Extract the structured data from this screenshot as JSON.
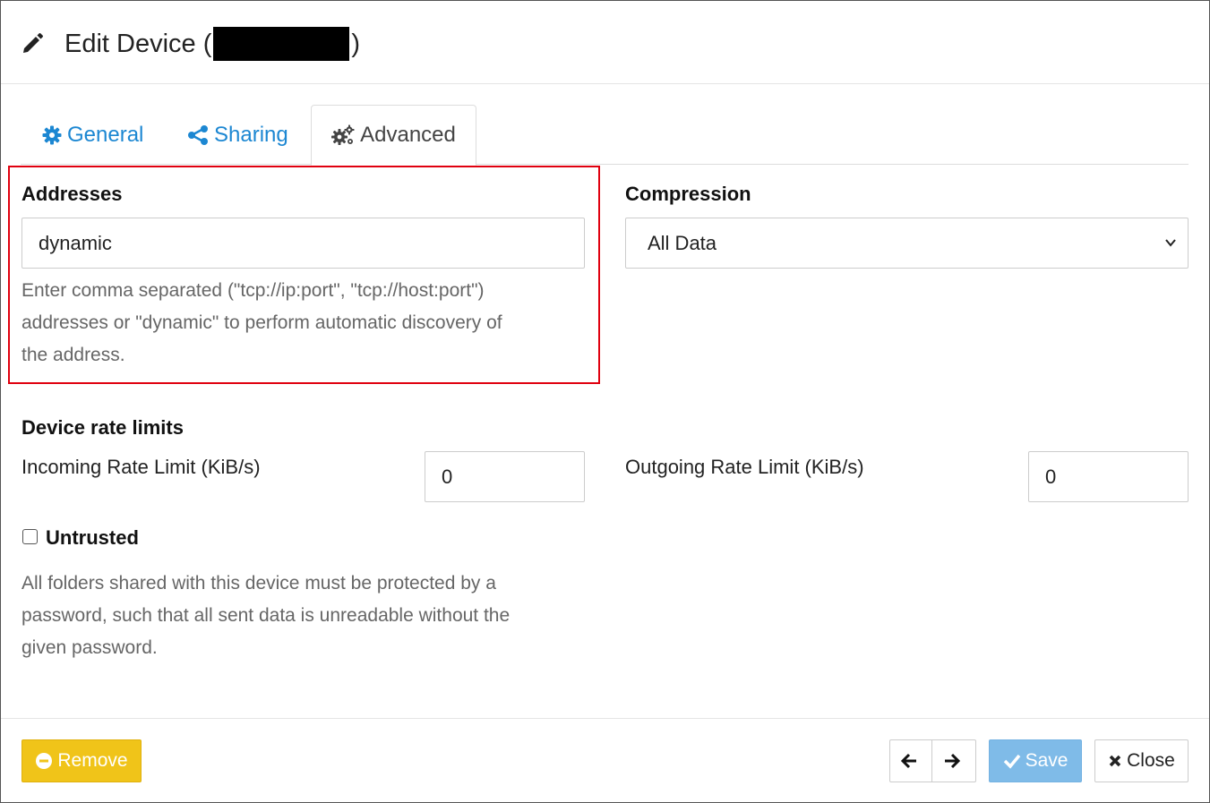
{
  "header": {
    "title_prefix": "Edit Device (",
    "title_suffix": ")",
    "icon": "pencil-icon"
  },
  "tabs": [
    {
      "label": "General",
      "icon": "gear-icon",
      "active": false
    },
    {
      "label": "Sharing",
      "icon": "share-icon",
      "active": false
    },
    {
      "label": "Advanced",
      "icon": "gears-icon",
      "active": true
    }
  ],
  "addresses": {
    "label": "Addresses",
    "value": "dynamic",
    "help_lines": [
      "Enter comma separated (\"tcp://ip:port\", \"tcp://host:port\")",
      "addresses or \"dynamic\" to perform automatic discovery of",
      "the address."
    ]
  },
  "compression": {
    "label": "Compression",
    "selected": "All Data"
  },
  "rate_limits": {
    "heading": "Device rate limits",
    "incoming_label": "Incoming Rate Limit (KiB/s)",
    "incoming_value": "0",
    "outgoing_label": "Outgoing Rate Limit (KiB/s)",
    "outgoing_value": "0"
  },
  "untrusted": {
    "label": "Untrusted",
    "checked": false,
    "help_lines": [
      "All folders shared with this device must be protected by a",
      "password, such that all sent data is unreadable without the",
      "given password."
    ]
  },
  "footer": {
    "remove_label": "Remove",
    "save_label": "Save",
    "close_label": "Close"
  },
  "colors": {
    "link": "#1c87d2",
    "remove": "#f0c419",
    "save": "#7fbbe8",
    "highlight": "#e0000f"
  }
}
